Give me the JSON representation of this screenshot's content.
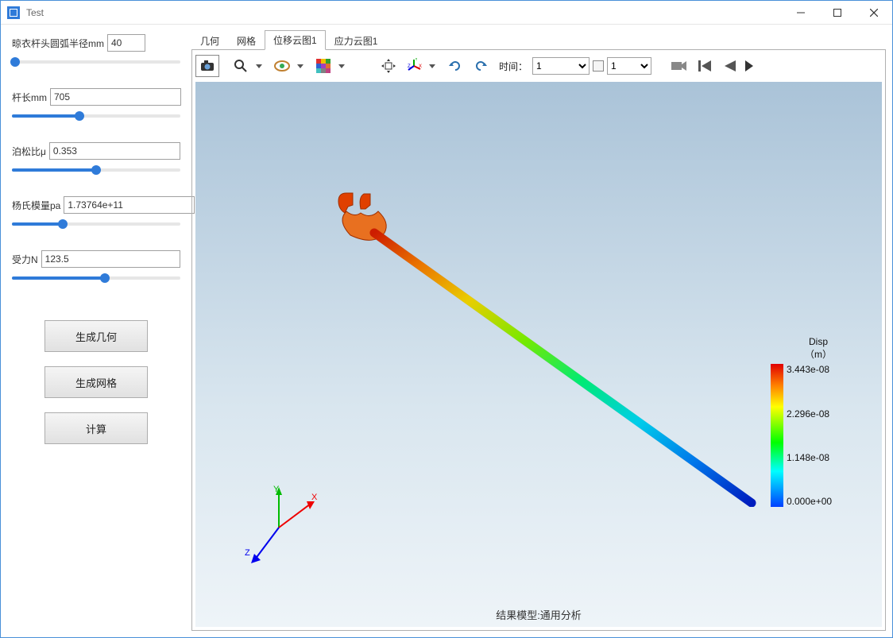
{
  "window": {
    "title": "Test"
  },
  "params": {
    "radius": {
      "label": "晾衣杆头圆弧半径mm",
      "value": "40",
      "fill": 2
    },
    "length": {
      "label": "杆长mm",
      "value": "705",
      "fill": 40
    },
    "poisson": {
      "label": "泊松比μ",
      "value": "0.353",
      "fill": 50
    },
    "young": {
      "label": "杨氏模量pa",
      "value": "1.73764e+11",
      "fill": 30
    },
    "force": {
      "label": "受力N",
      "value": "123.5",
      "fill": 55
    }
  },
  "buttons": {
    "gen_geom": "生成几何",
    "gen_mesh": "生成网格",
    "compute": "计算"
  },
  "tabs": {
    "geom": "几何",
    "mesh": "网格",
    "disp": "位移云图1",
    "stress": "应力云图1"
  },
  "toolbar": {
    "time_label": "时间：",
    "time_value": "1",
    "frame_value": "1"
  },
  "axes": {
    "x": "X",
    "y": "Y",
    "z": "Z"
  },
  "legend": {
    "title": "Disp",
    "unit": "（m）",
    "t1": "3.443e-08",
    "t2": "2.296e-08",
    "t3": "1.148e-08",
    "t4": "0.000e+00"
  },
  "bottom_label": "结果模型:通用分析"
}
